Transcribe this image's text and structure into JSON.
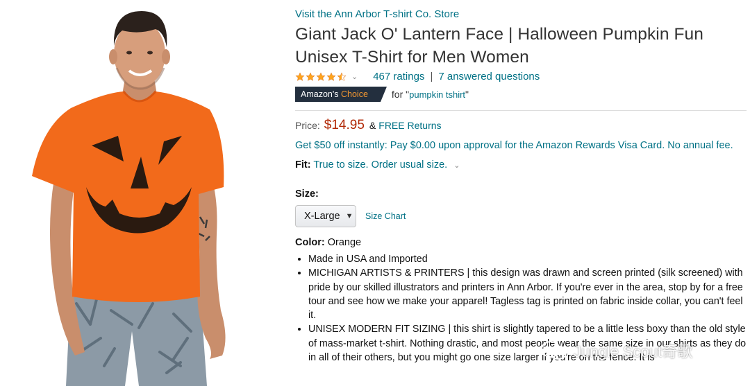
{
  "store_link": "Visit the Ann Arbor T-shirt Co. Store",
  "title": "Giant Jack O' Lantern Face | Halloween Pumpkin Fun Unisex T-Shirt for Men Women",
  "rating": {
    "stars": 4.5,
    "ratings_text": "467 ratings",
    "separator": "|",
    "questions_text": "7 answered questions"
  },
  "badge": {
    "prefix": "Amazon's",
    "choice": "Choice",
    "for_text": "for \"",
    "keyword": "pumpkin tshirt",
    "close_quote": "\""
  },
  "price": {
    "label": "Price:",
    "value": "$14.95",
    "amp": "&",
    "returns": "FREE Returns"
  },
  "promo": "Get $50 off instantly: Pay $0.00 upon approval for the Amazon Rewards Visa Card. No annual fee.",
  "fit": {
    "label": "Fit:",
    "value": "True to size. Order usual size."
  },
  "size": {
    "label": "Size:",
    "selected": "X-Large",
    "chart_link": "Size Chart"
  },
  "color": {
    "label": "Color:",
    "value": "Orange"
  },
  "bullets": [
    "Made in USA and Imported",
    "MICHIGAN ARTISTS & PRINTERS | this design was drawn and screen printed (silk screened) with pride by our skilled illustrators and printers in Ann Arbor. If you're ever in the area, stop by for a free tour and see how we make your apparel! Tagless tag is printed on fabric inside collar, you can't feel it.",
    "UNISEX MODERN FIT SIZING | this shirt is slightly tapered to be a little less boxy than the old style of mass-market t-shirt. Nothing drastic, and most people wear the same size in our shirts as they do in all of their others, but you might go one size larger if you're on the fence. It is"
  ],
  "watermark": "Jungle Scout奇歌",
  "colors": {
    "link": "#007185",
    "price": "#b12704",
    "badge_bg": "#232f3e",
    "badge_accent": "#f69931",
    "star": "#ffa41c",
    "shirt": "#f26a1b"
  },
  "icons": [
    "chevron-down-icon",
    "star-icon",
    "dropdown-caret-icon",
    "wechat-icon"
  ]
}
